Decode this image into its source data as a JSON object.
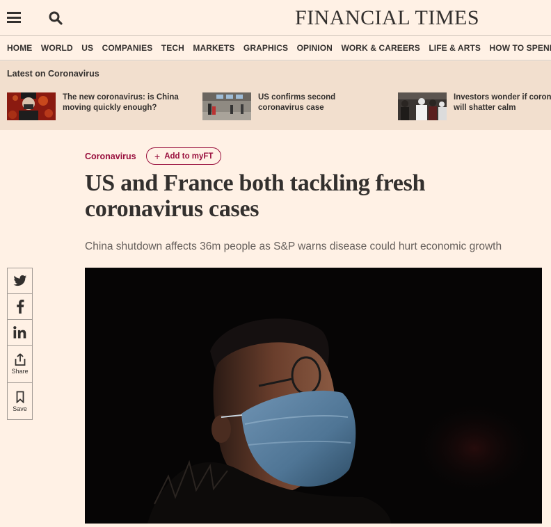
{
  "header": {
    "brand": "FINANCIAL TIMES",
    "menu_icon": "hamburger-menu-icon",
    "search_icon": "search-icon"
  },
  "nav": {
    "items": [
      "HOME",
      "WORLD",
      "US",
      "COMPANIES",
      "TECH",
      "MARKETS",
      "GRAPHICS",
      "OPINION",
      "WORK & CAREERS",
      "LIFE & ARTS",
      "HOW TO SPEND IT"
    ]
  },
  "latest": {
    "title": "Latest on Coronavirus",
    "stories": [
      {
        "text": "The new coronavirus: is China moving quickly enough?"
      },
      {
        "text": "US confirms second coronavirus case"
      },
      {
        "text": "Investors wonder if coronavirus will shatter calm"
      }
    ]
  },
  "article": {
    "topic": "Coronavirus",
    "add_myft": "Add to myFT",
    "headline": "US and France both tackling fresh coronavirus cases",
    "standfirst": "China shutdown affects 36m people as S&P warns disease could hurt economic growth"
  },
  "share": {
    "share_label": "Share",
    "save_label": "Save",
    "icons": [
      "twitter-icon",
      "facebook-icon",
      "linkedin-icon",
      "share-icon",
      "bookmark-icon"
    ]
  },
  "colors": {
    "background": "#fff1e5",
    "latest_background": "#f2dfce",
    "accent": "#990f3d",
    "text": "#33302e"
  }
}
